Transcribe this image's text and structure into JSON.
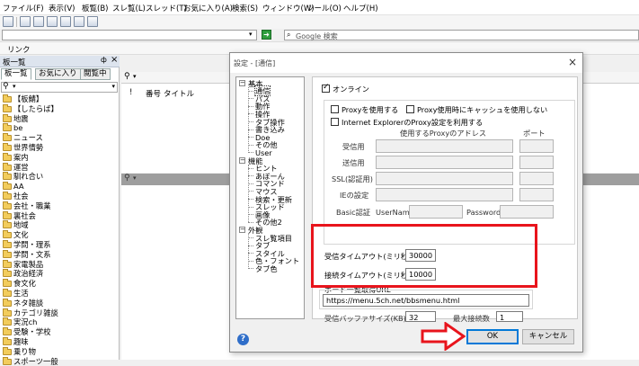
{
  "menu": [
    "ファイル(F)",
    "表示(V)",
    "板覧(B)",
    "スレ覧(L)",
    "スレッド(T)",
    "お気に入り(A)",
    "検索(S)",
    "ウィンドウ(W)",
    "ツール(O)",
    "ヘルプ(H)"
  ],
  "address": {
    "google_placeholder": "Google 検索"
  },
  "link_bar": "リンク",
  "left_pane": {
    "title": "板一覧",
    "pin": "ф",
    "close": "×",
    "tabs": [
      "板一覧",
      "お気に入り",
      "閲覧中"
    ],
    "boards": [
      "【板鯖】",
      "【したらば】",
      "地震",
      "be",
      "ニュース",
      "世界情勢",
      "案内",
      "運営",
      "馴れ合い",
      "AA",
      "社会",
      "会社・職業",
      "裏社会",
      "地域",
      "文化",
      "学問・理系",
      "学問・文系",
      "家電製品",
      "政治経済",
      "食文化",
      "生活",
      "ネタ雑談",
      "カテゴリ雑談",
      "実況ch",
      "受験・学校",
      "趣味",
      "乗り物",
      "スポーツ一般"
    ]
  },
  "thread_list": {
    "col_mark": "!",
    "col_number": "番号",
    "col_title": "タイトル"
  },
  "dialog": {
    "title": "設定 - [通信]",
    "close": "×",
    "tree": {
      "groups": [
        {
          "label": "基本",
          "items": [
            "通信",
            "パス",
            "動作",
            "操作",
            "タブ操作",
            "書き込み",
            "Doe",
            "その他",
            "User"
          ]
        },
        {
          "label": "機能",
          "items": [
            "ヒント",
            "あぼーん",
            "コマンド",
            "マウス",
            "検索・更新",
            "スレッド",
            "画像",
            "その他2"
          ]
        },
        {
          "label": "外観",
          "items": [
            "スレ覧項目",
            "タブ",
            "スタイル",
            "色・フォント",
            "タブ色"
          ]
        }
      ]
    },
    "online_label": "オンライン",
    "proxy_use": "Proxyを使用する",
    "proxy_nocache": "Proxy使用時にキャッシュを使用しない",
    "ie_proxy": "Internet ExplorerのProxy設定を利用する",
    "proxy_address_header": "使用するProxyのアドレス",
    "port_header": "ポート",
    "rows": [
      "受信用",
      "送信用",
      "SSL(認証用)",
      "IEの設定"
    ],
    "basic_auth": "Basic認証",
    "username": "UserName:",
    "password": "Password:",
    "recv_timeout_label": "受信タイムアウト(ミリ秒)",
    "recv_timeout_value": "30000",
    "conn_timeout_label": "接続タイムアウト(ミリ秒)",
    "conn_timeout_value": "10000",
    "board_url_group": "ボード一覧取得URL",
    "board_url_value": "https://menu.5ch.net/bbsmenu.html",
    "buffer_label": "受信バッファサイズ(KB)",
    "buffer_value": "32",
    "max_conn_label": "最大接続数",
    "max_conn_value": "1",
    "ok": "OK",
    "cancel": "キャンセル",
    "help": "?"
  },
  "colors": {
    "highlight": "#e8141c",
    "accent": "#0078d7"
  }
}
